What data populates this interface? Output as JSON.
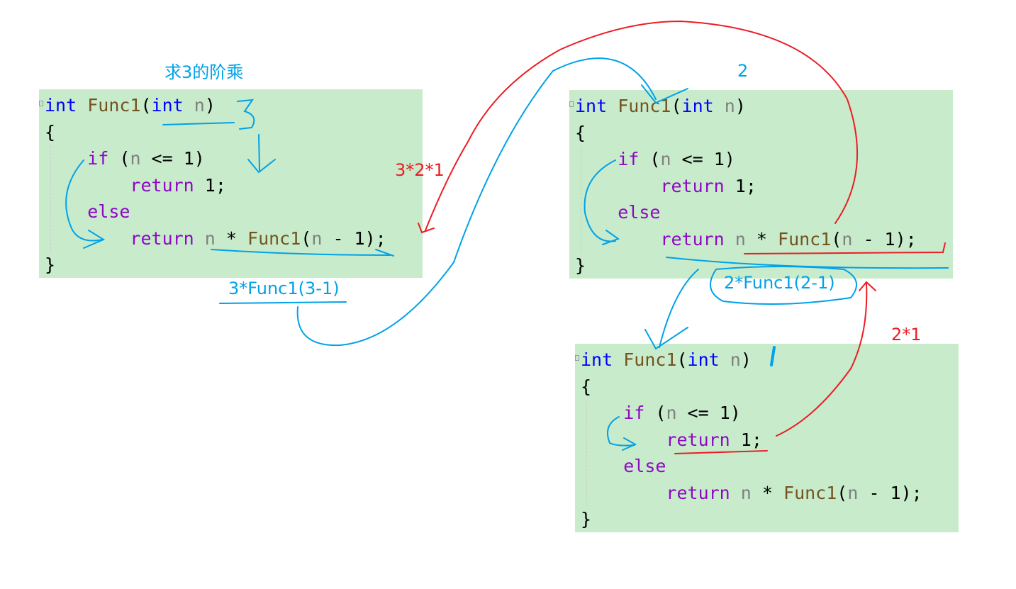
{
  "code_lines": [
    [
      [
        "int",
        "kw"
      ],
      [
        " ",
        "pl"
      ],
      [
        "Func1",
        "fn"
      ],
      [
        "(",
        "pl"
      ],
      [
        "int",
        "kw"
      ],
      [
        " ",
        "pl"
      ],
      [
        "n",
        "pm"
      ],
      [
        ")",
        "pl"
      ]
    ],
    [
      [
        "{",
        "pl"
      ]
    ],
    [
      [
        "    ",
        "pl"
      ],
      [
        "if",
        "ctl"
      ],
      [
        " (",
        "pl"
      ],
      [
        "n",
        "pm"
      ],
      [
        " <= 1)",
        "pl"
      ]
    ],
    [
      [
        "        ",
        "pl"
      ],
      [
        "return",
        "ctl"
      ],
      [
        " 1;",
        "pl"
      ]
    ],
    [
      [
        "    ",
        "pl"
      ],
      [
        "else",
        "ctl"
      ]
    ],
    [
      [
        "        ",
        "pl"
      ],
      [
        "return",
        "ctl"
      ],
      [
        " ",
        "pl"
      ],
      [
        "n",
        "pm"
      ],
      [
        " * ",
        "pl"
      ],
      [
        "Func1",
        "fn"
      ],
      [
        "(",
        "pl"
      ],
      [
        "n",
        "pm"
      ],
      [
        " - 1);",
        "pl"
      ]
    ],
    [
      [
        "}",
        "pl"
      ]
    ]
  ],
  "annotations": {
    "title": "求3的阶乘",
    "call2_arg": "2",
    "result_top": "3*2*1",
    "expr1": "3*Func1(3-1)",
    "expr2": "2*Func1(2-1)",
    "result_mid": "2*1"
  },
  "colors": {
    "ink_blue": "#00a2e8",
    "ink_red": "#ed1c24",
    "code_bg": "#c7ebcb"
  }
}
